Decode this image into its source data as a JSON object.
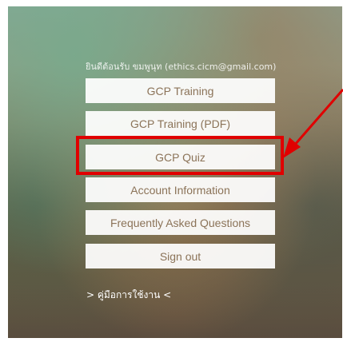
{
  "greeting": "ยินดีต้อนรับ ขมพูนุท (ethics.cicm@gmail.com)",
  "menu": {
    "items": [
      {
        "label": "GCP Training"
      },
      {
        "label": "GCP Training (PDF)"
      },
      {
        "label": "GCP Quiz"
      },
      {
        "label": "Account Information"
      },
      {
        "label": "Frequently Asked Questions"
      },
      {
        "label": "Sign out"
      }
    ]
  },
  "manual_link": "> คู่มือการใช้งาน <",
  "colors": {
    "button_text": "#8b7358",
    "highlight": "#e00000"
  }
}
